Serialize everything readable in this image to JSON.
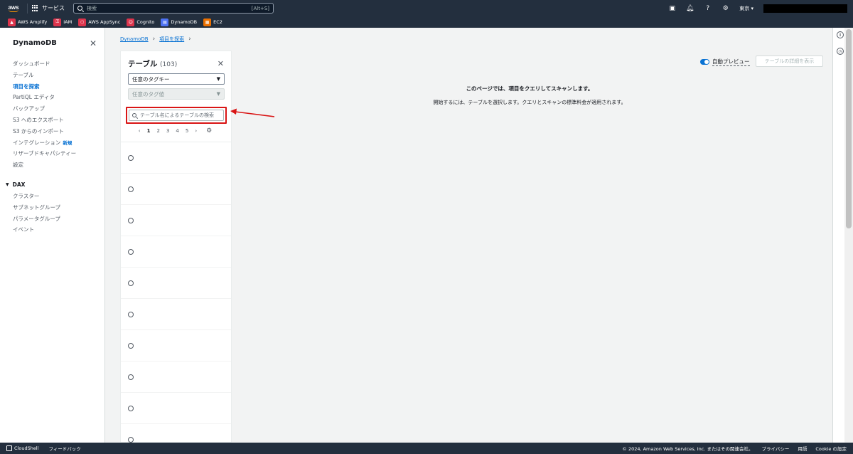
{
  "topbar": {
    "logo": "aws",
    "services_label": "サービス",
    "search_placeholder": "検索",
    "search_shortcut": "[Alt+S]",
    "region": "東京 ▾"
  },
  "favorites": [
    {
      "label": "AWS Amplify",
      "color": "#dd344c"
    },
    {
      "label": "IAM",
      "color": "#dd344c"
    },
    {
      "label": "AWS AppSync",
      "color": "#dd344c"
    },
    {
      "label": "Cognito",
      "color": "#dd344c"
    },
    {
      "label": "DynamoDB",
      "color": "#4d72f3"
    },
    {
      "label": "EC2",
      "color": "#ed7100"
    }
  ],
  "sidebar": {
    "title": "DynamoDB",
    "items": [
      {
        "label": "ダッシュボード"
      },
      {
        "label": "テーブル"
      },
      {
        "label": "項目を探索"
      },
      {
        "label": "PartiQL エディタ"
      },
      {
        "label": "バックアップ"
      },
      {
        "label": "S3 へのエクスポート"
      },
      {
        "label": "S3 からのインポート"
      },
      {
        "label": "インテグレーション",
        "badge": "新規"
      },
      {
        "label": "リザーブドキャパシティー"
      },
      {
        "label": "設定"
      }
    ],
    "dax_section": "DAX",
    "dax_items": [
      {
        "label": "クラスター"
      },
      {
        "label": "サブネットグループ"
      },
      {
        "label": "パラメータグループ"
      },
      {
        "label": "イベント"
      }
    ]
  },
  "breadcrumb": {
    "root": "DynamoDB",
    "current": "項目を探索"
  },
  "tables_panel": {
    "title": "テーブル",
    "count": "(103)",
    "tag_key_select": "任意のタグキー",
    "tag_value_select": "任意のタグ値",
    "search_placeholder": "テーブル名によるテーブルの検索",
    "pages": [
      "1",
      "2",
      "3",
      "4",
      "5"
    ]
  },
  "main": {
    "auto_preview": "自動プレビュー",
    "details_button": "テーブルの詳細を表示",
    "empty_title": "このページでは、項目をクエリしてスキャンします。",
    "empty_desc": "開始するには、テーブルを選択します。クエリとスキャンの標準料金が適用されます。"
  },
  "footer": {
    "cloudshell": "CloudShell",
    "feedback": "フィードバック",
    "copyright": "© 2024, Amazon Web Services, Inc. またはその関連会社。",
    "privacy": "プライバシー",
    "terms": "用語",
    "cookie": "Cookie の設定"
  }
}
